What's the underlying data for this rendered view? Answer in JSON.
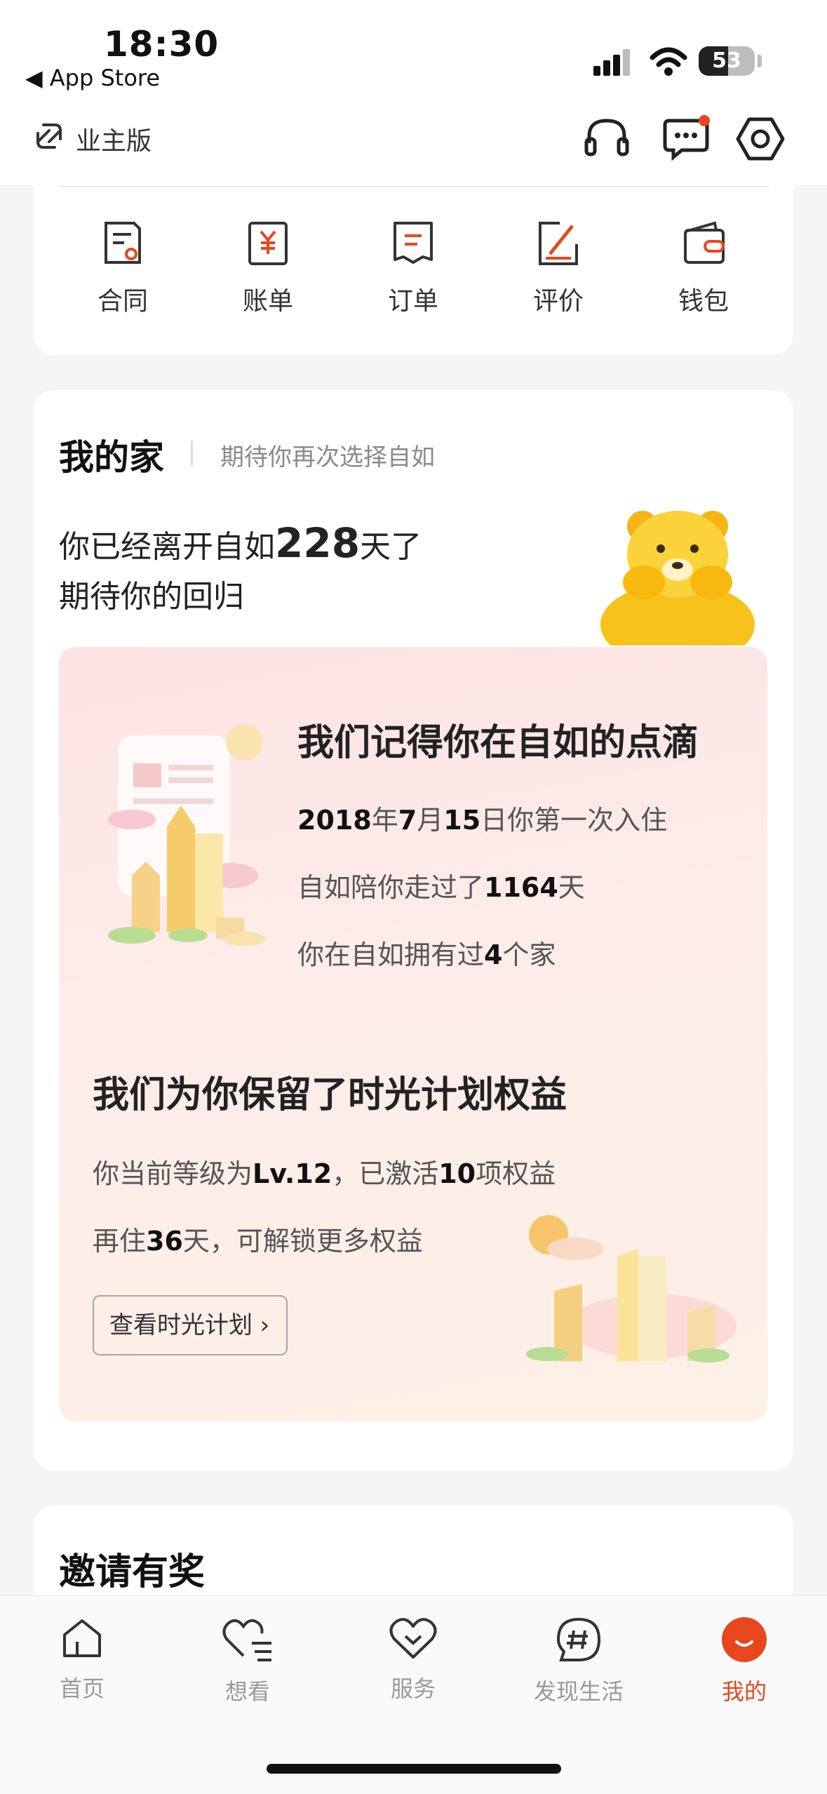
{
  "status": {
    "time": "18:30",
    "back": "◀ App Store",
    "battery": "53"
  },
  "header": {
    "owner_label": "业主版",
    "icons": [
      "switch-icon",
      "headset-icon",
      "message-icon",
      "settings-icon"
    ]
  },
  "quick_actions": [
    {
      "label": "合同",
      "icon": "contract-icon"
    },
    {
      "label": "账单",
      "icon": "bill-icon"
    },
    {
      "label": "订单",
      "icon": "order-icon"
    },
    {
      "label": "评价",
      "icon": "review-icon"
    },
    {
      "label": "钱包",
      "icon": "wallet-icon"
    }
  ],
  "home": {
    "title": "我的家",
    "subtitle": "期待你再次选择自如",
    "left_prefix": "你已经离开自如",
    "left_days": "228",
    "left_suffix": "天了",
    "line2": "期待你的回归"
  },
  "memory": {
    "title": "我们记得你在自如的点滴",
    "l1": {
      "year": "2018",
      "y": "年",
      "month": "7",
      "m": "月",
      "day": "15",
      "rest": "日你第一次入住"
    },
    "l2": {
      "pre": "自如陪你走过了",
      "num": "1164",
      "post": "天"
    },
    "l3": {
      "pre": "你在自如拥有过",
      "num": "4",
      "post": "个家"
    }
  },
  "keep": {
    "title": "我们为你保留了时光计划权益",
    "l1": {
      "pre": "你当前等级为",
      "lv": "Lv.12",
      "mid": "，已激活",
      "num": "10",
      "post": "项权益"
    },
    "l2": {
      "pre": "再住",
      "num": "36",
      "post": "天，可解锁更多权益"
    },
    "button": "查看时光计划 ›"
  },
  "invite": {
    "title": "邀请有奖"
  },
  "tabs": [
    {
      "label": "首页",
      "icon": "home-icon"
    },
    {
      "label": "想看",
      "icon": "wishlist-icon"
    },
    {
      "label": "服务",
      "icon": "service-icon"
    },
    {
      "label": "发现生活",
      "icon": "discover-icon"
    },
    {
      "label": "我的",
      "icon": "profile-icon",
      "active": true
    }
  ],
  "colors": {
    "accent": "#e8461d",
    "panel": "#fde8e6"
  }
}
